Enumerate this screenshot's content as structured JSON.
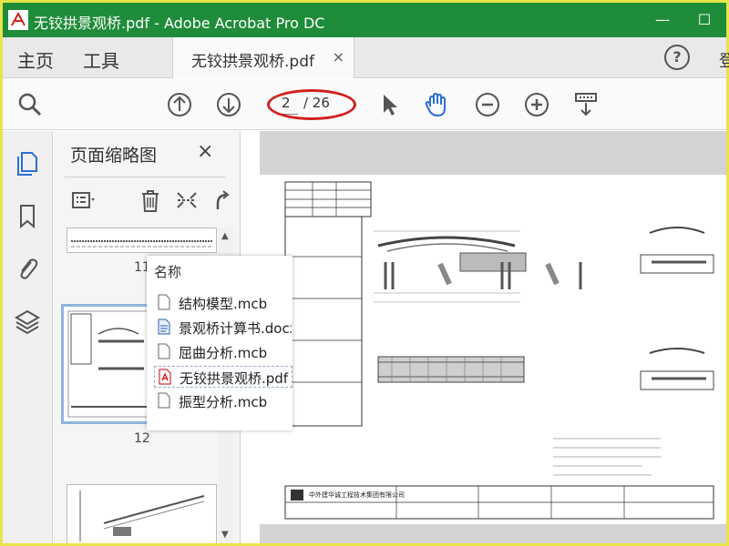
{
  "window": {
    "title": "无铰拱景观桥.pdf - Adobe Acrobat Pro DC",
    "minimize": "—",
    "restore": "☐"
  },
  "tabs": {
    "home": "主页",
    "tools": "工具",
    "document": "无铰拱景观桥.pdf",
    "close": "×",
    "help": "?",
    "signin": "登"
  },
  "toolbar": {
    "current_page": "2",
    "total_pages": "/ 26"
  },
  "panel": {
    "title": "页面缩略图",
    "close": "×",
    "thumbnails": [
      {
        "label": "11"
      },
      {
        "label": "12"
      },
      {
        "label": ""
      }
    ]
  },
  "popup": {
    "header": "名称",
    "files": [
      {
        "name": "结构模型.mcb",
        "icon": "doc-icon"
      },
      {
        "name": "景观桥计算书.docx",
        "icon": "word-icon"
      },
      {
        "name": "屈曲分析.mcb",
        "icon": "doc-icon"
      },
      {
        "name": "无铰拱景观桥.pdf",
        "icon": "pdf-icon"
      },
      {
        "name": "振型分析.mcb",
        "icon": "doc-icon"
      }
    ]
  },
  "drawing": {
    "company": "中外建华诚工程技术集团有限公司"
  },
  "colors": {
    "titlebar": "#1f8c39",
    "accent_blue": "#2b6fd6",
    "highlight_red": "#d22020",
    "frame": "#e8e44a"
  }
}
